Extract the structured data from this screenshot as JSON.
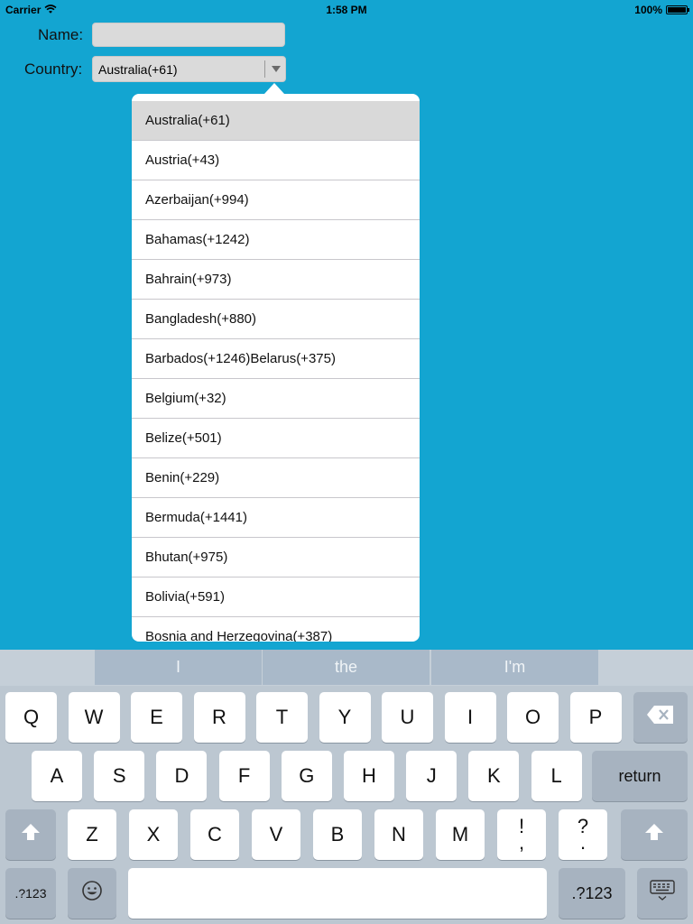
{
  "status_bar": {
    "carrier": "Carrier",
    "time": "1:58 PM",
    "battery": "100%",
    "battery_level": 1.0
  },
  "form": {
    "name_label": "Name:",
    "name_value": "",
    "country_label": "Country:",
    "country_value": "Australia(+61)"
  },
  "country_list": {
    "selected_index": 0,
    "items": [
      "Australia(+61)",
      "Austria(+43)",
      "Azerbaijan(+994)",
      "Bahamas(+1242)",
      "Bahrain(+973)",
      "Bangladesh(+880)",
      "Barbados(+1246)Belarus(+375)",
      "Belgium(+32)",
      "Belize(+501)",
      "Benin(+229)",
      "Bermuda(+1441)",
      "Bhutan(+975)",
      "Bolivia(+591)",
      "Bosnia and Herzegovina(+387)"
    ]
  },
  "keyboard": {
    "predictions": [
      "I",
      "the",
      "I'm"
    ],
    "row1": [
      "Q",
      "W",
      "E",
      "R",
      "T",
      "Y",
      "U",
      "I",
      "O",
      "P"
    ],
    "row2": [
      "A",
      "S",
      "D",
      "F",
      "G",
      "H",
      "J",
      "K",
      "L"
    ],
    "row3": [
      "Z",
      "X",
      "C",
      "V",
      "B",
      "N",
      "M"
    ],
    "excl_top": "!",
    "excl_bottom": ",",
    "quest_top": "?",
    "quest_bottom": ".",
    "return_label": "return",
    "numbers_label": ".?123",
    "icons": {
      "backspace": "backspace-icon",
      "shift": "shift-icon",
      "emoji": "emoji-icon",
      "hide_keyboard": "hide-keyboard-icon",
      "wifi": "wifi-icon"
    },
    "colors": {
      "background": "#13a5d1",
      "keyboard": "#bcc7d1",
      "key_dark": "#a7b3c0"
    }
  }
}
